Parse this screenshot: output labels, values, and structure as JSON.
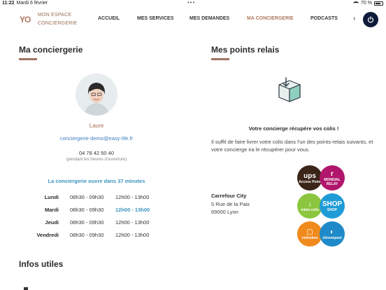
{
  "status_bar": {
    "time": "11:22",
    "date": "Mardi 6 février",
    "battery": "70 %"
  },
  "header": {
    "logo": "YO",
    "brand_line1": "MON ESPACE",
    "brand_line2": "CONCIERGERIE",
    "nav": [
      {
        "label": "ACCUEIL",
        "active": false
      },
      {
        "label": "MES SERVICES",
        "active": false
      },
      {
        "label": "MES DEMANDES",
        "active": false
      },
      {
        "label": "MA CONCIERGERIE",
        "active": true
      },
      {
        "label": "PODCASTS",
        "active": false
      }
    ],
    "next_label": "›",
    "colors": {
      "accent": "#b07a5f",
      "power_bg": "#0f1b3a"
    }
  },
  "conciergerie": {
    "title": "Ma conciergerie",
    "name": "Laure",
    "email": "conciergerie-demo@easy-life.fr",
    "phone": "04 78 42 50 40",
    "phone_note": "(pendant les heures d'ouverture)",
    "open_status": "La conciergerie ouvre dans 37 minutes",
    "hours": [
      {
        "day": "Lundi",
        "slot1": "08h30 - 09h30",
        "slot2": "12h00 - 13h00",
        "today": false
      },
      {
        "day": "Mardi",
        "slot1": "08h30 - 09h30",
        "slot2": "12h00 - 13h00",
        "today": true
      },
      {
        "day": "Jeudi",
        "slot1": "08h30 - 09h30",
        "slot2": "12h00 - 13h00",
        "today": false
      },
      {
        "day": "Vendredi",
        "slot1": "08h30 - 09h30",
        "slot2": "12h00 - 13h00",
        "today": false
      }
    ]
  },
  "relais": {
    "title": "Mes points relais",
    "subtitle": "Votre concierge récupère vos colis !",
    "description": "Il suffit de faire livrer votre colis dans l'un des points-relais suivants, et votre concierge ira le récupérer pour vous.",
    "store_name": "Carrefour City",
    "address_line1": "5 Rue de la Paix",
    "address_line2": "69000 Lyon",
    "carriers": [
      {
        "mark": "ups",
        "label": "Access Point",
        "color": "#3b2418"
      },
      {
        "mark": "r",
        "label": "MONDIAL RELAY",
        "color": "#b0166b"
      },
      {
        "mark": "↓",
        "label": "relais colis",
        "color": "#8cc63f"
      },
      {
        "mark": "SHOP",
        "label": "SHOP",
        "color": "#1e9bd7"
      },
      {
        "mark": "▢",
        "label": "colissimo",
        "color": "#f08a1c"
      },
      {
        "mark": "◐",
        "label": "chronopost",
        "color": "#1f8ac9"
      }
    ]
  },
  "infos": {
    "title": "Infos utiles"
  }
}
